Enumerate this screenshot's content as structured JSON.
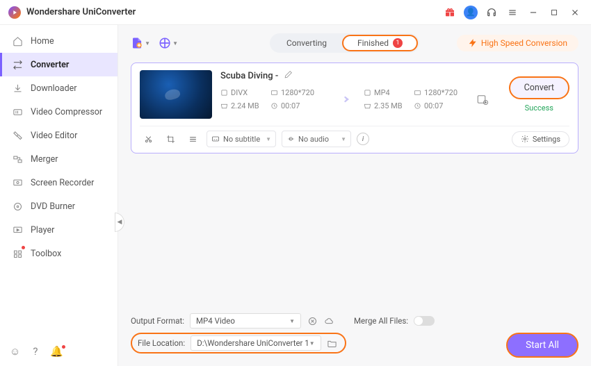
{
  "title": "Wondershare UniConverter",
  "sidebar": {
    "items": [
      {
        "label": "Home"
      },
      {
        "label": "Converter"
      },
      {
        "label": "Downloader"
      },
      {
        "label": "Video Compressor"
      },
      {
        "label": "Video Editor"
      },
      {
        "label": "Merger"
      },
      {
        "label": "Screen Recorder"
      },
      {
        "label": "DVD Burner"
      },
      {
        "label": "Player"
      },
      {
        "label": "Toolbox"
      }
    ]
  },
  "tabs": {
    "converting": "Converting",
    "finished": "Finished",
    "finished_count": "1"
  },
  "hsc": "High Speed Conversion",
  "file": {
    "name": "Scuba Diving -",
    "src_format": "DIVX",
    "src_res": "1280*720",
    "src_size": "2.24 MB",
    "src_dur": "00:07",
    "dst_format": "MP4",
    "dst_res": "1280*720",
    "dst_size": "2.35 MB",
    "dst_dur": "00:07",
    "subtitle": "No subtitle",
    "audio": "No audio",
    "convert": "Convert",
    "status": "Success",
    "settings": "Settings"
  },
  "bottom": {
    "output_format_label": "Output Format:",
    "output_format_value": "MP4 Video",
    "merge_label": "Merge All Files:",
    "file_location_label": "File Location:",
    "file_location_value": "D:\\Wondershare UniConverter 1",
    "start_all": "Start All"
  }
}
